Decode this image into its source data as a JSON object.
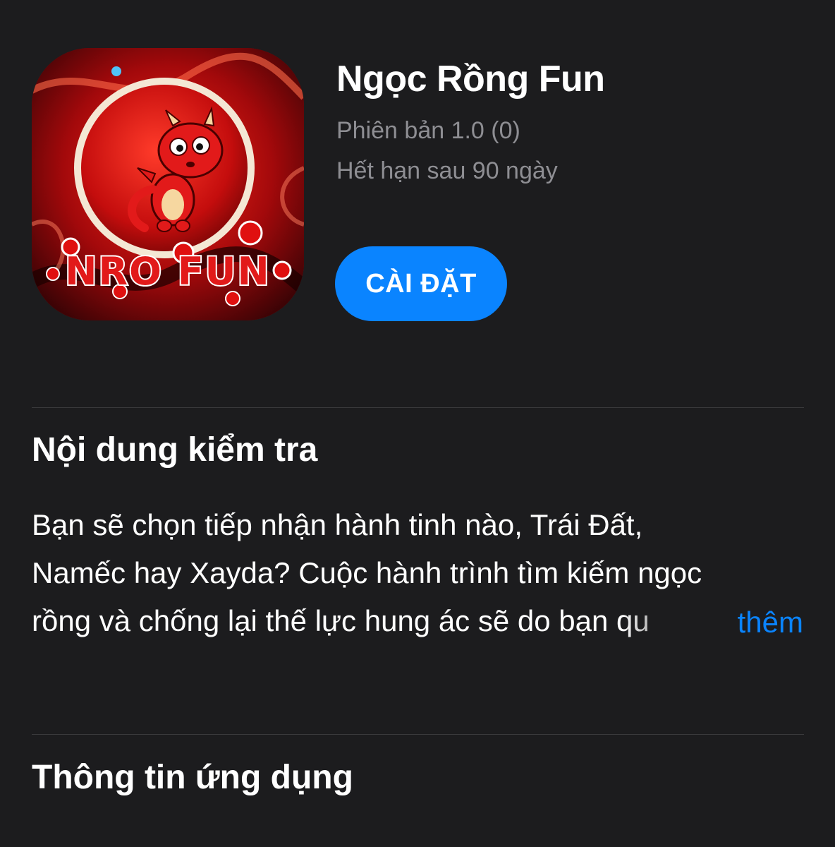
{
  "app": {
    "name": "Ngọc Rồng Fun",
    "version": "Phiên bản 1.0 (0)",
    "expiry": "Hết hạn sau 90 ngày",
    "install_label": "CÀI ĐẶT",
    "icon": "dragon-app-icon",
    "icon_text": "NRO FUN"
  },
  "review_section": {
    "heading": "Nội dung kiểm tra",
    "lines": [
      "Bạn sẽ chọn tiếp nhận hành tinh nào, Trái Đất,",
      "Namếc hay Xayda? Cuộc hành trình tìm kiếm ngọc",
      "rồng và chống lại thế lực hung ác sẽ do bạn qu"
    ],
    "more_label": "thêm"
  },
  "info_section": {
    "heading": "Thông tin ứng dụng"
  },
  "colors": {
    "background": "#1c1c1e",
    "accent": "#0a84ff",
    "secondary_text": "#8e8e93",
    "divider": "#3a3a3c"
  }
}
